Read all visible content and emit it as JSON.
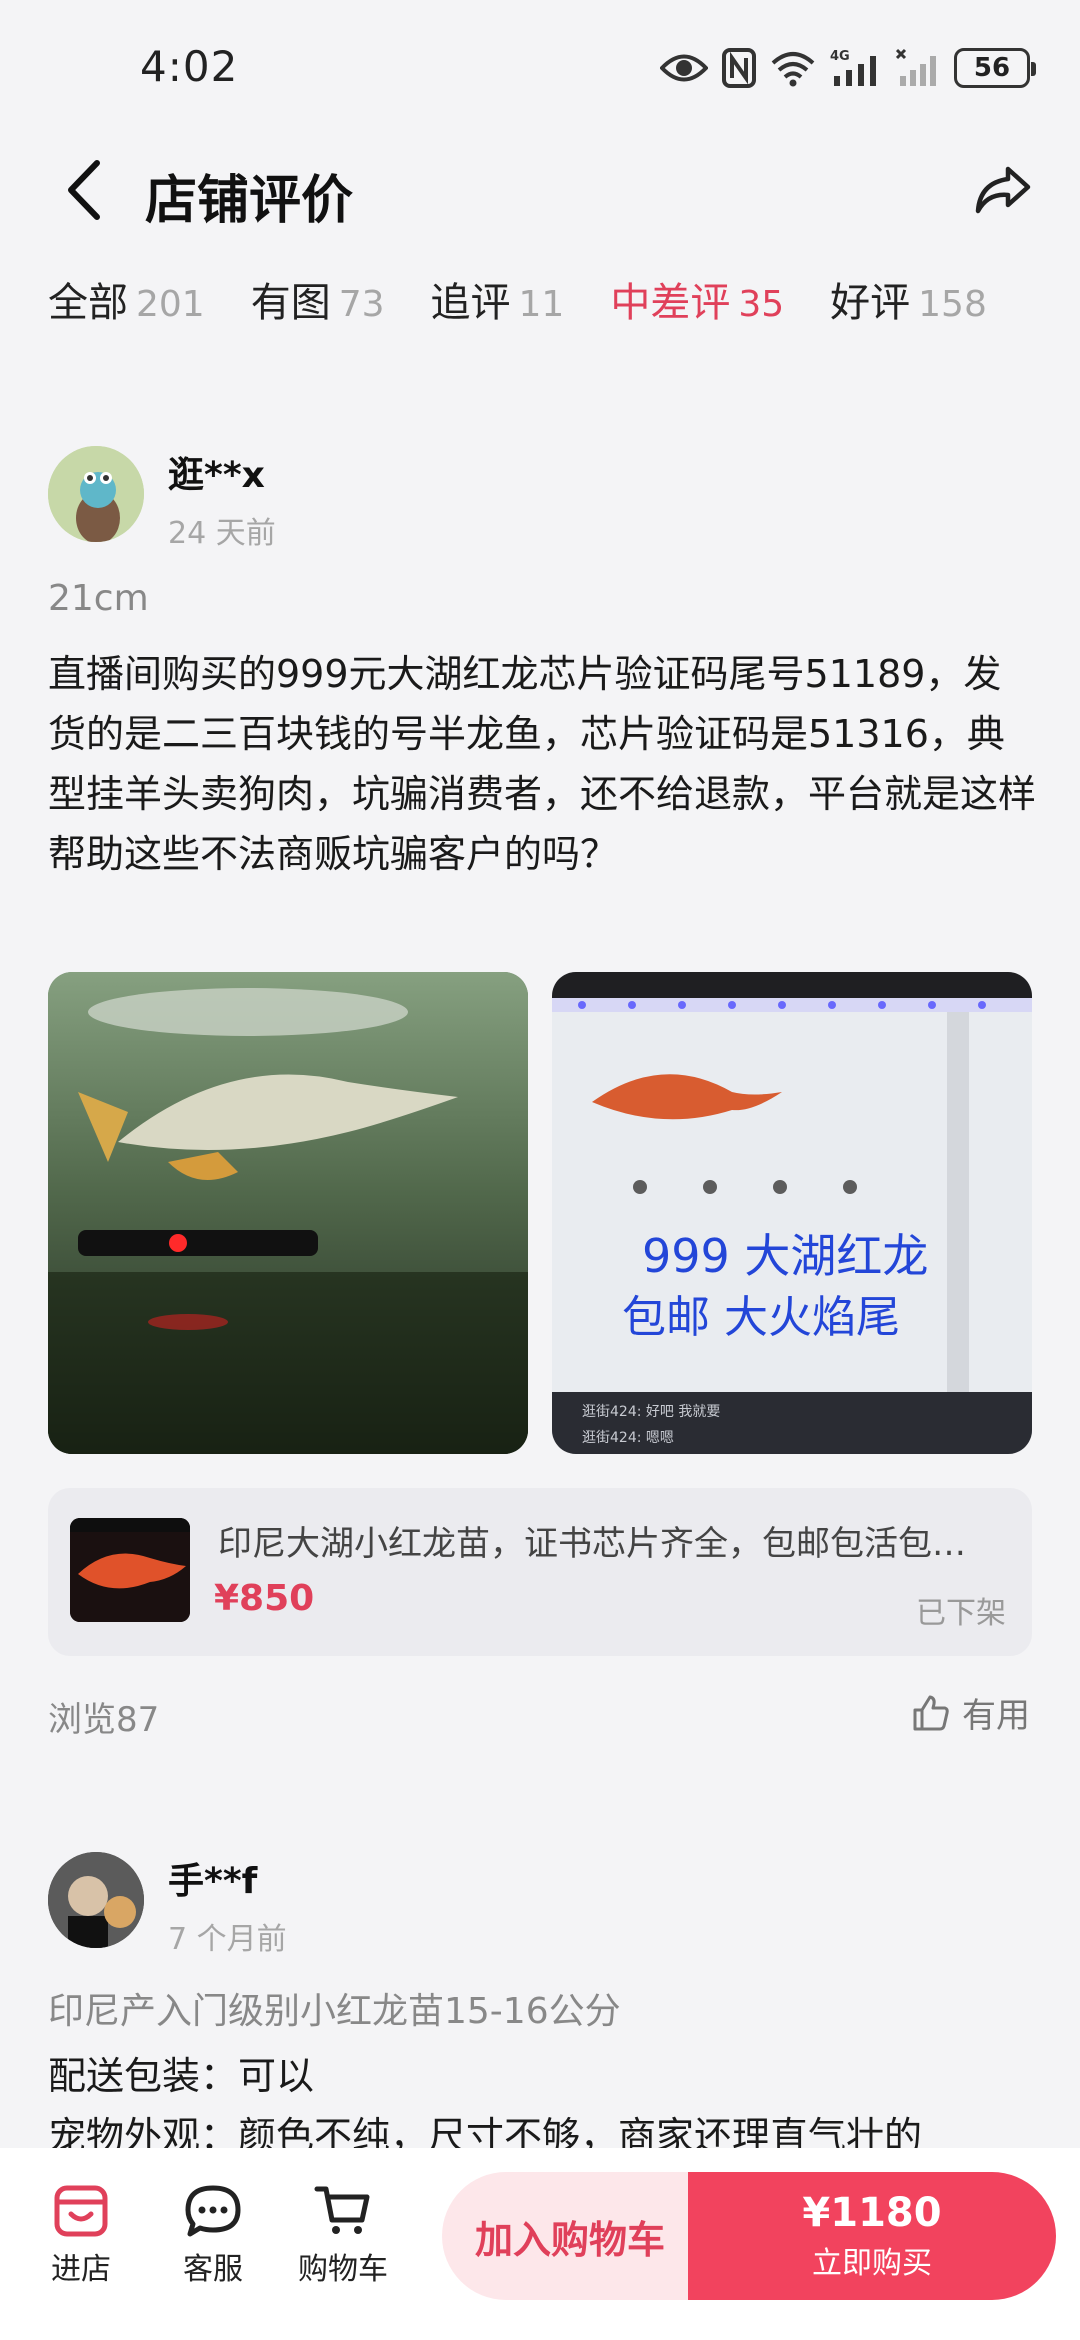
{
  "status_bar": {
    "time": "4:02",
    "network": "4G",
    "battery": "56"
  },
  "header": {
    "title": "店铺评价"
  },
  "tabs": [
    {
      "label": "全部",
      "count": "201"
    },
    {
      "label": "有图",
      "count": "73"
    },
    {
      "label": "追评",
      "count": "11"
    },
    {
      "label": "中差评",
      "count": "35",
      "active": true
    },
    {
      "label": "好评",
      "count": "158"
    }
  ],
  "reviews": [
    {
      "username": "逛**x",
      "time": "24 天前",
      "spec": "21cm",
      "text": "直播间购买的999元大湖红龙芯片验证码尾号51189，发货的是二三百块钱的号半龙鱼，芯片验证码是51316，典型挂羊头卖狗肉，坑骗消费者，还不给退款，平台就是这样帮助这些不法商贩坑骗客户的吗？",
      "photo_text": {
        "line1": "999 大湖红龙",
        "line2": "包邮 大火焰尾",
        "overlay1": "逛街424: 好吧 我就要",
        "overlay2": "逛街424: 嗯嗯"
      },
      "product": {
        "title": "印尼大湖小红龙苗，证书芯片齐全，包邮包活包…",
        "price": "¥850",
        "status": "已下架"
      },
      "views": "浏览87",
      "useful_label": "有用"
    },
    {
      "username": "手**f",
      "time": "7 个月前",
      "spec": "印尼产入门级别小红龙苗15-16公分",
      "line1": "配送包装：可以",
      "line2": "宠物外观：颜色不纯，尺寸不够，商家还理直气壮的"
    }
  ],
  "bottom_bar": {
    "store_label": "进店",
    "service_label": "客服",
    "cart_label": "购物车",
    "add_cart_label": "加入购物车",
    "buy_price": "¥1180",
    "buy_label": "立即购买"
  },
  "colors": {
    "accent": "#e0405a",
    "buy_button": "#f2435e",
    "background": "#f4f4f6"
  }
}
